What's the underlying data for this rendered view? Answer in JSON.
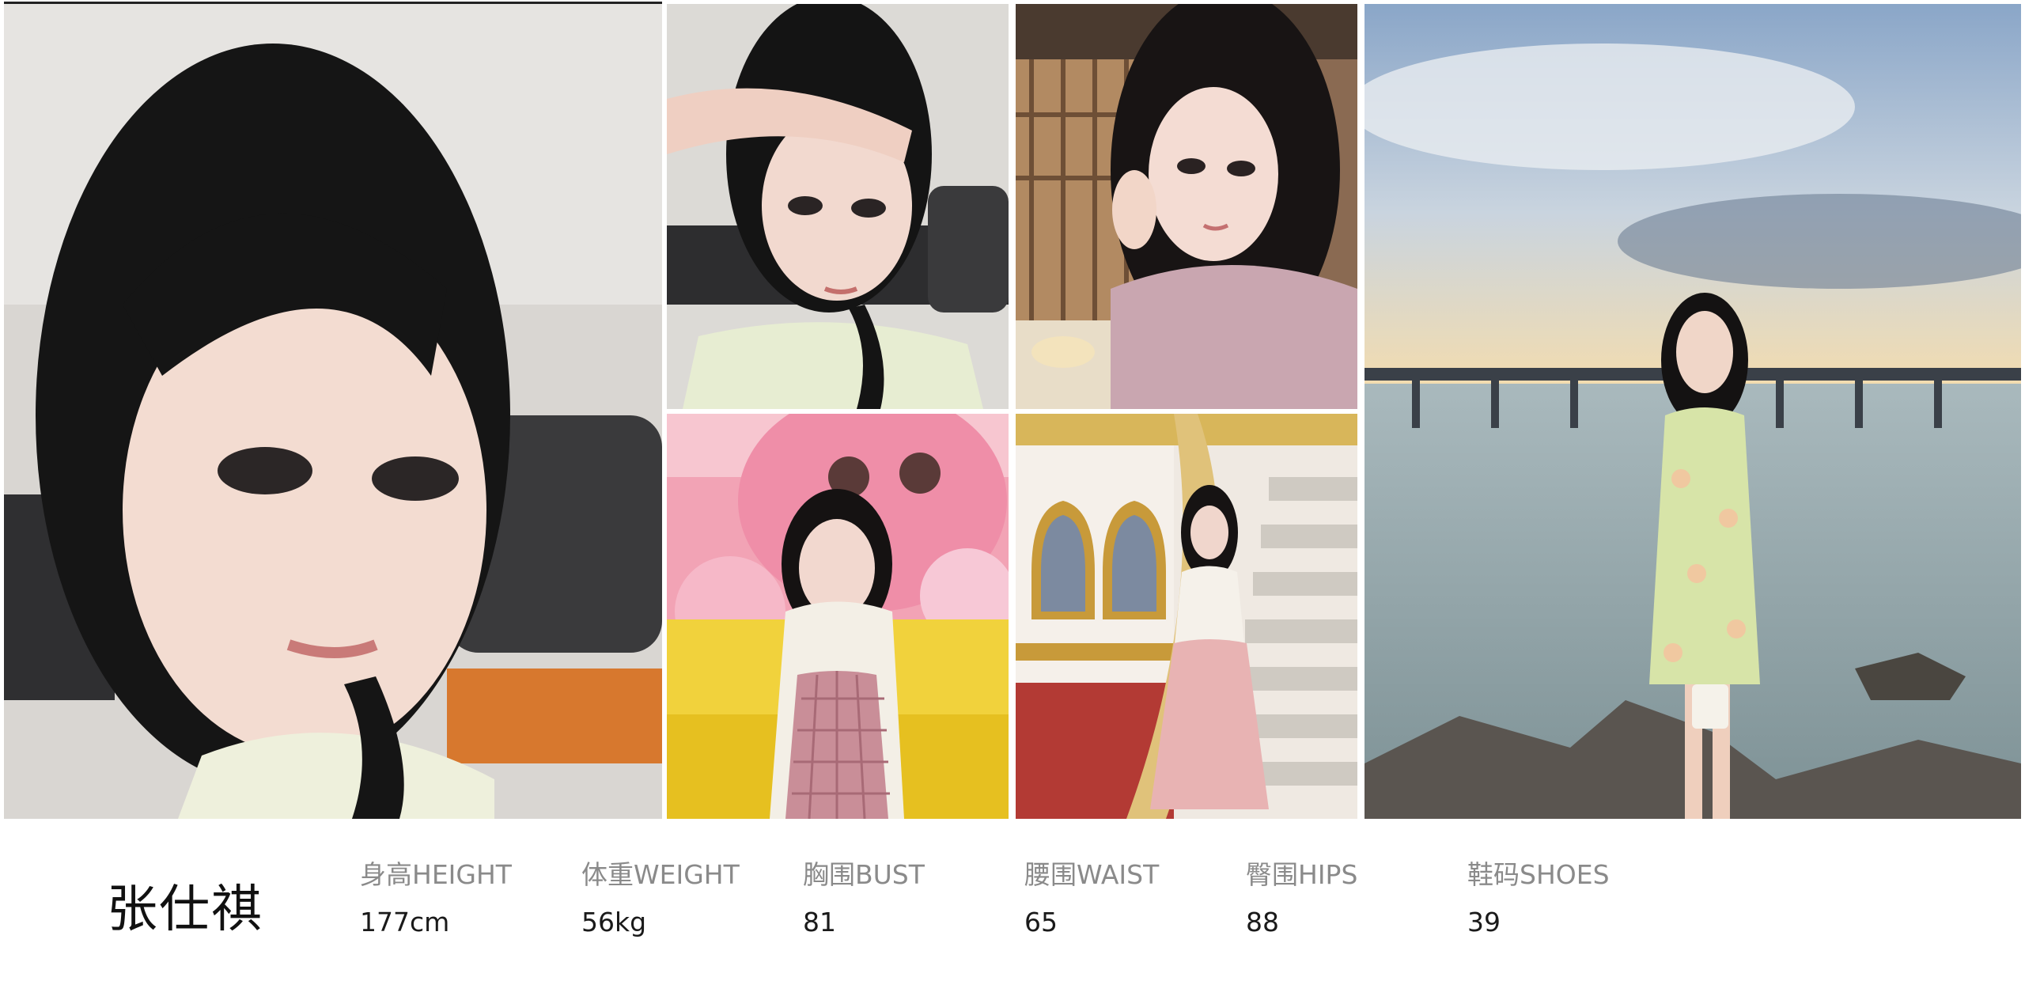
{
  "profile": {
    "name": "张仕祺",
    "stats": [
      {
        "label": "身高HEIGHT",
        "value": "177cm"
      },
      {
        "label": "体重WEIGHT",
        "value": "56kg"
      },
      {
        "label": "胸围BUST",
        "value": "81"
      },
      {
        "label": "腰围WAIST",
        "value": "65"
      },
      {
        "label": "臀围HIPS",
        "value": "88"
      },
      {
        "label": "鞋码SHOES",
        "value": "39"
      }
    ]
  },
  "colors": {
    "text_primary": "#111111",
    "text_label": "#8a8a8a",
    "background": "#ffffff"
  }
}
